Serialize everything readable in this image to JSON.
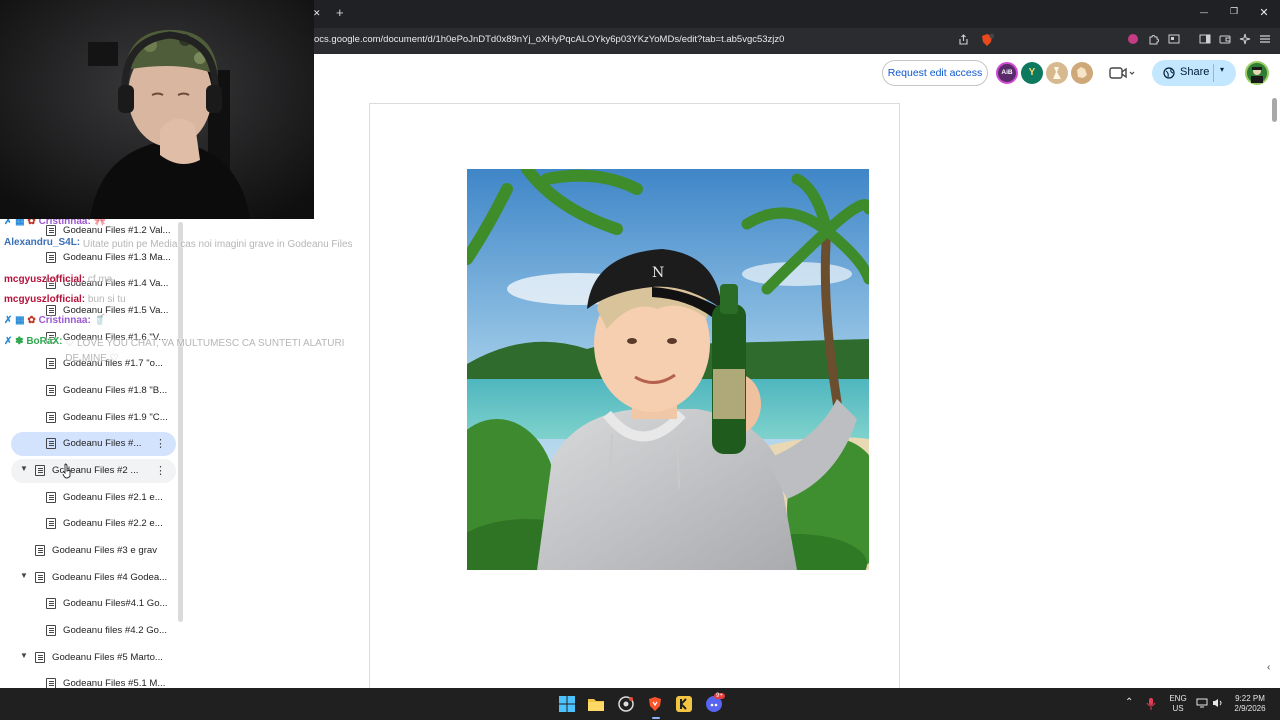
{
  "browser": {
    "url": "ocs.google.com/document/d/1h0ePoJnDTd0x89nYj_oXHyPqcALOYky6p03YKzYoMDs/edit?tab=t.ab5vgc53zjz0",
    "tab_close": "✕",
    "new_tab": "+",
    "window_controls": [
      "—",
      "❐",
      "✕"
    ]
  },
  "docs_toolbar": {
    "request_edit_label": "Request edit access",
    "share_label": "Share",
    "avatar_initials": [
      "AiB",
      "Y",
      "",
      ""
    ]
  },
  "outline": {
    "items": [
      {
        "label": "Godeanu Files #1.2 Val...",
        "level": 2
      },
      {
        "label": "Godeanu Files #1.3 Ma...",
        "level": 2
      },
      {
        "label": "Godeanu Files #1.4 Va...",
        "level": 2
      },
      {
        "label": "Godeanu Files #1.5 Va...",
        "level": 2
      },
      {
        "label": "Godeanu Files #1.6 \"V...",
        "level": 2
      },
      {
        "label": "Godeanu files #1.7 \"o...",
        "level": 2
      },
      {
        "label": "Godeanu Files #1.8 \"B...",
        "level": 2
      },
      {
        "label": "Godeanu Files #1.9 \"C...",
        "level": 2
      },
      {
        "label": "Godeanu Files #...",
        "level": 2,
        "selected": true
      },
      {
        "label": "Godeanu Files #2 ...",
        "level": 1,
        "expandable": true,
        "hovered": true
      },
      {
        "label": "Godeanu Files #2.1 e...",
        "level": 2
      },
      {
        "label": "Godeanu Files #2.2 e...",
        "level": 2
      },
      {
        "label": "Godeanu Files #3 e grav",
        "level": 1
      },
      {
        "label": "Godeanu Files #4 Godea...",
        "level": 1,
        "expandable": true
      },
      {
        "label": "Godeanu Files#4.1 Go...",
        "level": 2
      },
      {
        "label": "Godeanu files #4.2 Go...",
        "level": 2
      },
      {
        "label": "Godeanu Files #5 Marto...",
        "level": 1,
        "expandable": true
      },
      {
        "label": "Godeanu Files #5.1 M...",
        "level": 2
      }
    ]
  },
  "chat": [
    {
      "user": "Cristinnaa:",
      "color": "#9b59d0",
      "message": "🎀"
    },
    {
      "user": "Alexandru_S4L:",
      "color": "#3b6fb6",
      "message": "Uitate putin pe Media cas noi imagini grave in Godeanu Files"
    },
    {
      "user": "mcgyuszlofficial:",
      "color": "#b5123b",
      "message": "cf ma"
    },
    {
      "user": "mcgyuszlofficial:",
      "color": "#b5123b",
      "message": "bun si tu"
    },
    {
      "user": "Cristinnaa:",
      "color": "#9b59d0",
      "message": "🥤"
    },
    {
      "user": "BoRaX:",
      "color": "#2fa84f",
      "message": "♡ LOVE YOU CHAT, VA MULTUMESC CA SUNTETI ALATURI DE MINE ♡"
    }
  ],
  "taskbar": {
    "lang_line1": "ENG",
    "lang_line2": "US",
    "time": "9:22 PM",
    "date": "2/9/2026",
    "discord_badge": "9+"
  }
}
